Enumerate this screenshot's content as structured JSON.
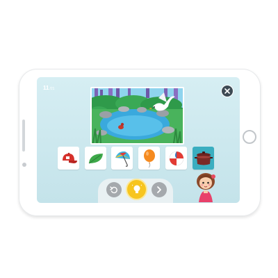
{
  "game": {
    "level_current": "11",
    "level_total": "/21"
  },
  "options": [
    {
      "name": "red-cap",
      "selected": false
    },
    {
      "name": "green-leaf",
      "selected": false
    },
    {
      "name": "umbrella",
      "selected": false
    },
    {
      "name": "orange-balloon",
      "selected": false
    },
    {
      "name": "beach-ball",
      "selected": false
    },
    {
      "name": "cooking-pot",
      "selected": true
    }
  ],
  "colors": {
    "screen_bg": "#c8e6ec",
    "selected_tile": "#3aaec0",
    "hint_button": "#f7c51f",
    "nav_button": "#a5a9ad",
    "close_button": "#3e4a54"
  },
  "icons": {
    "close": "close-icon",
    "back": "undo-icon",
    "hint": "lightbulb-icon",
    "next": "chevron-right-icon"
  }
}
